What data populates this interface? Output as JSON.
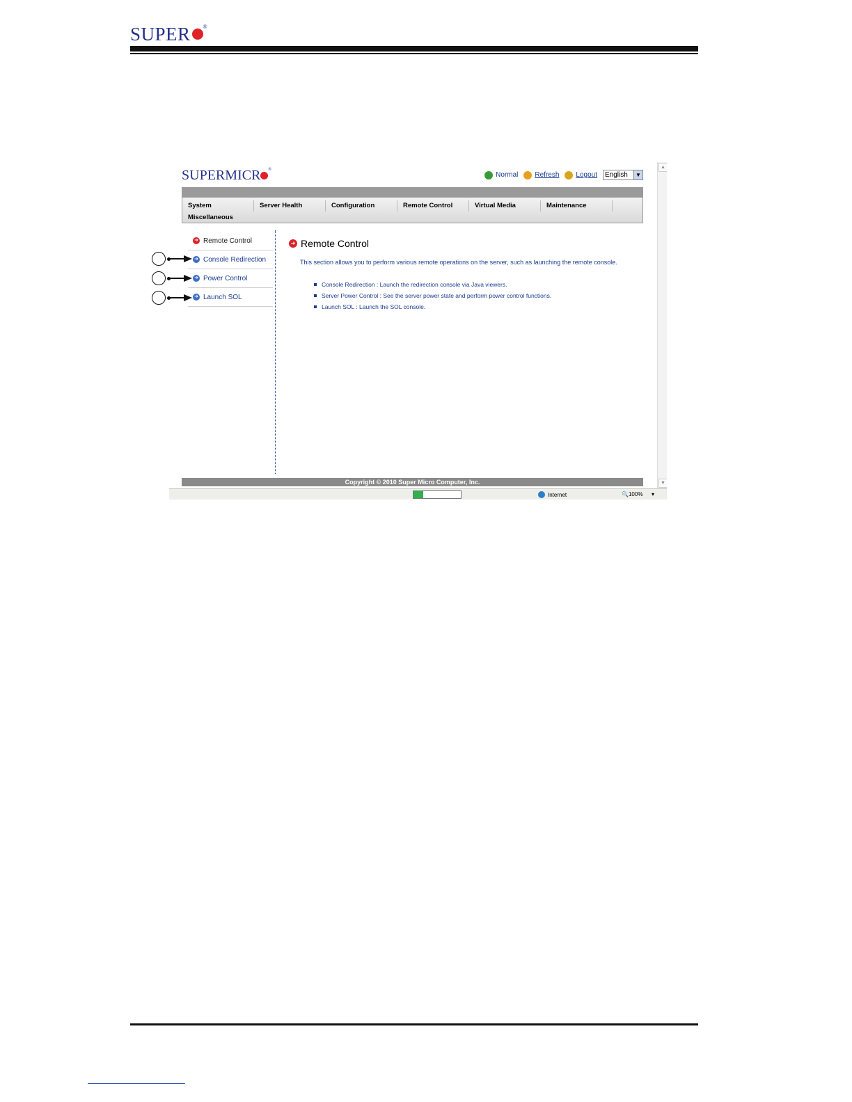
{
  "doc_header": {
    "brand": "SUPER"
  },
  "app": {
    "logo": "SUPERMICR",
    "status": "Normal",
    "refresh": "Refresh",
    "logout": "Logout",
    "language": "English"
  },
  "nav": {
    "items": [
      "System",
      "Server Health",
      "Configuration",
      "Remote Control",
      "Virtual Media",
      "Maintenance"
    ],
    "misc": "Miscellaneous"
  },
  "sidebar": {
    "items": [
      {
        "label": "Remote Control",
        "active": true
      },
      {
        "label": "Console Redirection"
      },
      {
        "label": "Power Control"
      },
      {
        "label": "Launch SOL"
      }
    ]
  },
  "main": {
    "title": "Remote Control",
    "description": "This section allows you to perform various remote operations on the server, such as launching the remote console.",
    "bullets": [
      "Console Redirection : Launch the redirection console via Java viewers.",
      "Server Power Control : See the server power state and perform power control functions.",
      "Launch SOL : Launch the SOL console."
    ]
  },
  "footer": "Copyright © 2010 Super Micro Computer, Inc.",
  "statusbar": {
    "zone": "Internet",
    "zoom": "100%"
  }
}
